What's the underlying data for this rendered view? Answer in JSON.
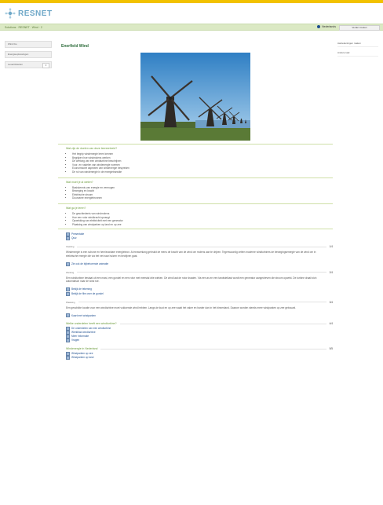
{
  "brand": {
    "name": "RESNET",
    "accent": "#f2c200",
    "green": "#dbe9c4"
  },
  "breadcrumb": "Solutions · RESNET · Wind · 2",
  "lang": "Nederlands",
  "search_button": "Verder zoeken",
  "left_nav": [
    {
      "label": "Wind bio",
      "count": ""
    },
    {
      "label": "Energieoplossingen",
      "count": ""
    },
    {
      "label": "Lesactiviteiten",
      "count": "0"
    }
  ],
  "right_nav": [
    "Aantekeningen maken",
    "Andere taal"
  ],
  "page_title": "Enerfield Wind",
  "photo_alt": "Windmills",
  "sections": [
    {
      "title": "Wat zijn de doelen van deze leereenheid?",
      "items": [
        "Het begrip windenergie leren kennen",
        "Begrijpen hoe windmolens werken",
        "De werking van een windturbine beschrijven",
        "Voor- en nadelen van windenergie noemen",
        "Economische aspecten van windenergie bespreken",
        "De rol van windenergie in de energietransitie"
      ]
    },
    {
      "title": "Wat moet je al weten?",
      "items": [
        "Basiskennis van energie en vermogen",
        "Beweging en kracht",
        "Elektrische stroom",
        "Duurzame energiebronnen"
      ]
    },
    {
      "title": "Wat ga je leren?",
      "items": [
        "De geschiedenis van windmolens",
        "Hoe een rotor windkracht opvangt",
        "Opwekking van elektriciteit met een generator",
        "Plaatsing van windparken op land en op zee"
      ]
    }
  ],
  "quick_links": [
    "Presentatie",
    "Quiz"
  ],
  "blocks": [
    {
      "label": "Inleiding",
      "num": "1/4",
      "text": "Windenergie is een schone en hernieuwbare energiebron. Al eeuwenlang gebruikt de mens de kracht van de wind om molens aan te drijven. Tegenwoordig zetten moderne windturbines de bewegingsenergie van de wind om in elektrische energie die via het net naar huizen en bedrijven gaat.",
      "links": [
        "Zie ook de bijbehorende animatie"
      ]
    },
    {
      "label": "Werking",
      "num": "2/4",
      "text": "Een windturbine bestaat uit een mast, een gondel en een rotor met meestal drie wieken. De wind laat de rotor draaien. Via een as en een tandwielkast wordt een generator aangedreven die stroom opwekt. De turbine draait zich automatisch naar de wind toe.",
      "links": [
        "Bekijk de tekening",
        "Bekijk de film over de gondel"
      ]
    },
    {
      "label": "Plaatsing",
      "num": "3/4",
      "text": "Een geschikte locatie voor een windturbine moet voldoende wind hebben. Langs de kust en op zee waait het vaker en harder dan in het binnenland. Daarom worden steeds meer windparken op zee gebouwd.",
      "links": [
        "Kaart met windparken"
      ]
    }
  ],
  "q4": {
    "title": "Welke onderdelen heeft een windturbine?",
    "num": "4/4",
    "links": [
      "De onderdelen van een windturbine",
      "Werkblad windturbine",
      "Meer informatie",
      "Vragen"
    ]
  },
  "q5": {
    "title": "Windenergie in Nederland",
    "num": "5/5",
    "links": [
      "Windparken op zee",
      "Windparken op land"
    ]
  }
}
